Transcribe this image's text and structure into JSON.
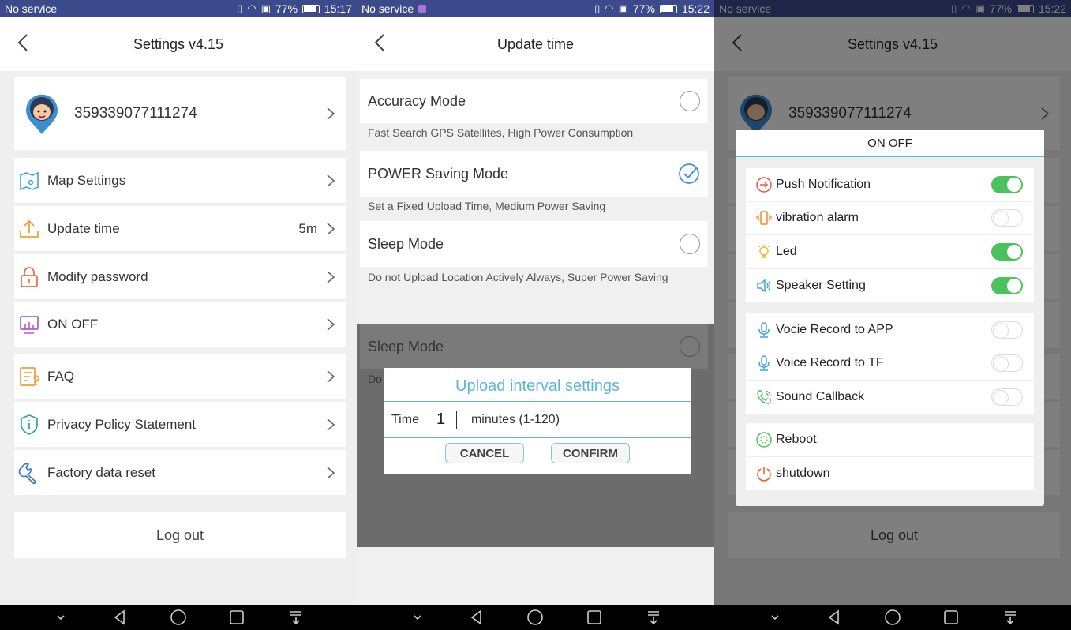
{
  "status_bars": [
    {
      "carrier": "No service",
      "battery": "77%",
      "time": "15:17"
    },
    {
      "carrier": "No service",
      "battery": "77%",
      "time": "15:22"
    },
    {
      "carrier": "No service",
      "battery": "77%",
      "time": "15:22"
    }
  ],
  "settings": {
    "title": "Settings v4.15",
    "device_id": "359339077111274",
    "items": [
      {
        "label": "Map Settings",
        "value": "",
        "icon": "map-icon"
      },
      {
        "label": "Update time",
        "value": "5m",
        "icon": "upload-icon"
      },
      {
        "label": "Modify password",
        "value": "",
        "icon": "lock-icon"
      },
      {
        "label": "ON OFF",
        "value": "",
        "icon": "monitor-icon"
      },
      {
        "label": "FAQ",
        "value": "",
        "icon": "faq-icon"
      },
      {
        "label": "Privacy Policy Statement",
        "value": "",
        "icon": "shield-icon"
      },
      {
        "label": "Factory data reset",
        "value": "",
        "icon": "wrench-icon"
      }
    ],
    "logout": "Log out"
  },
  "update_time": {
    "title": "Update time",
    "modes": [
      {
        "label": "Accuracy Mode",
        "desc": "Fast Search GPS Satellites, High Power Consumption",
        "selected": false
      },
      {
        "label": "POWER Saving Mode",
        "desc": "Set a Fixed Upload Time, Medium Power Saving",
        "selected": true
      },
      {
        "label": "Sleep Mode",
        "desc": "Do not Upload Location Actively Always, Super Power Saving",
        "selected": false
      }
    ],
    "ghost_label": "Sleep Mode",
    "ghost_desc_prefix": "Do",
    "dialog": {
      "title": "Upload interval settings",
      "time_label": "Time",
      "value": "1",
      "unit": "minutes (1-120)",
      "cancel": "CANCEL",
      "confirm": "CONFIRM"
    }
  },
  "onoff": {
    "title": "ON OFF",
    "group1": [
      {
        "label": "Push Notification",
        "on": true,
        "icon": "push-notification-icon",
        "color": "#e8534a"
      },
      {
        "label": "vibration alarm",
        "on": false,
        "icon": "vibration-icon",
        "color": "#f08a2a"
      },
      {
        "label": "Led",
        "on": true,
        "icon": "bulb-icon",
        "color": "#f2b632"
      },
      {
        "label": "Speaker Setting",
        "on": true,
        "icon": "speaker-icon",
        "color": "#3fa3e0"
      }
    ],
    "group2": [
      {
        "label": "Vocie Record to APP",
        "on": false,
        "icon": "microphone-icon",
        "color": "#3fa3e0"
      },
      {
        "label": "Voice Record to TF",
        "on": false,
        "icon": "microphone-icon",
        "color": "#3fa3e0"
      },
      {
        "label": "Sound Callback",
        "on": false,
        "icon": "phone-icon",
        "color": "#4cc25c"
      }
    ],
    "group3": [
      {
        "label": "Reboot",
        "icon": "reboot-icon",
        "color": "#4cc25c"
      },
      {
        "label": "shutdown",
        "icon": "power-icon",
        "color": "#f0662a"
      }
    ]
  },
  "colors": {
    "statusbar": "#3c4a8c",
    "toggle_on": "#4cc25c",
    "dialog_accent": "#5bb7d6",
    "check": "#4a90e2"
  }
}
